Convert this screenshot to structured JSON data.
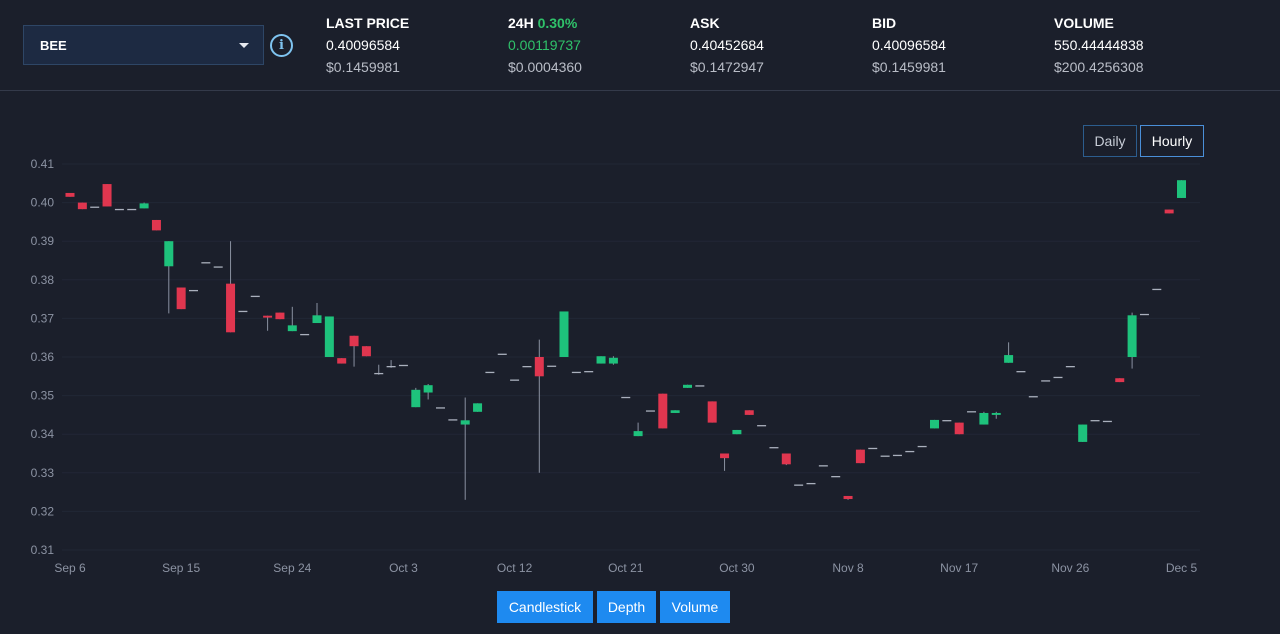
{
  "market": {
    "symbol": "BEE"
  },
  "stats": {
    "last_price": {
      "label": "LAST PRICE",
      "value": "0.40096584",
      "usd": "$0.1459981"
    },
    "change24h": {
      "label": "24H",
      "percent": "0.30%",
      "value": "0.00119737",
      "usd": "$0.0004360"
    },
    "ask": {
      "label": "ASK",
      "value": "0.40452684",
      "usd": "$0.1472947"
    },
    "bid": {
      "label": "BID",
      "value": "0.40096584",
      "usd": "$0.1459981"
    },
    "volume": {
      "label": "VOLUME",
      "value": "550.44444838",
      "usd": "$200.4256308"
    }
  },
  "interval_toggle": {
    "daily": "Daily",
    "hourly": "Hourly",
    "selected": "Hourly"
  },
  "tabs": {
    "candlestick": "Candlestick",
    "depth": "Depth",
    "volume": "Volume"
  },
  "colors": {
    "up": "#1ec27c",
    "down": "#e0364f",
    "accent": "#1e8af0",
    "background": "#1b1f2b"
  },
  "chart_data": {
    "type": "candlestick",
    "ylim": [
      0.31,
      0.41
    ],
    "yticks": [
      "0.31",
      "0.32",
      "0.33",
      "0.34",
      "0.35",
      "0.36",
      "0.37",
      "0.38",
      "0.39",
      "0.40",
      "0.41"
    ],
    "xticks": [
      "Sep 6",
      "Sep 15",
      "Sep 24",
      "Oct 3",
      "Oct 12",
      "Oct 21",
      "Oct 30",
      "Nov 8",
      "Nov 17",
      "Nov 26",
      "Dec 5"
    ],
    "x_start": "Sep 6",
    "candles": [
      {
        "date": "Sep 6",
        "o": 0.4025,
        "h": 0.4025,
        "l": 0.4015,
        "c": 0.4015
      },
      {
        "date": "Sep 7",
        "o": 0.4,
        "h": 0.4,
        "l": 0.3983,
        "c": 0.3983
      },
      {
        "date": "Sep 8",
        "o": 0.3988,
        "h": 0.3988,
        "l": 0.3985,
        "c": 0.3985
      },
      {
        "date": "Sep 9",
        "o": 0.4048,
        "h": 0.4048,
        "l": 0.399,
        "c": 0.399
      },
      {
        "date": "Sep 10",
        "o": 0.3982,
        "h": 0.3982,
        "l": 0.3979,
        "c": 0.3979
      },
      {
        "date": "Sep 11",
        "o": 0.3982,
        "h": 0.3982,
        "l": 0.3979,
        "c": 0.3979
      },
      {
        "date": "Sep 12",
        "o": 0.3985,
        "h": 0.4,
        "l": 0.3985,
        "c": 0.3998
      },
      {
        "date": "Sep 13",
        "o": 0.3955,
        "h": 0.3955,
        "l": 0.3928,
        "c": 0.3928
      },
      {
        "date": "Sep 14",
        "o": 0.3835,
        "h": 0.39,
        "l": 0.3713,
        "c": 0.39
      },
      {
        "date": "Sep 15",
        "o": 0.378,
        "h": 0.378,
        "l": 0.3724,
        "c": 0.3724
      },
      {
        "date": "Sep 16",
        "o": 0.3772,
        "h": 0.3772,
        "l": 0.3769,
        "c": 0.3769
      },
      {
        "date": "Sep 17",
        "o": 0.3844,
        "h": 0.3844,
        "l": 0.3841,
        "c": 0.3841
      },
      {
        "date": "Sep 18",
        "o": 0.3833,
        "h": 0.3833,
        "l": 0.383,
        "c": 0.383
      },
      {
        "date": "Sep 19",
        "o": 0.379,
        "h": 0.39,
        "l": 0.3664,
        "c": 0.3664
      },
      {
        "date": "Sep 20",
        "o": 0.3718,
        "h": 0.3718,
        "l": 0.3715,
        "c": 0.3715
      },
      {
        "date": "Sep 21",
        "o": 0.3757,
        "h": 0.3757,
        "l": 0.3754,
        "c": 0.3754
      },
      {
        "date": "Sep 22",
        "o": 0.3707,
        "h": 0.3707,
        "l": 0.3668,
        "c": 0.3702
      },
      {
        "date": "Sep 23",
        "o": 0.3715,
        "h": 0.3715,
        "l": 0.3698,
        "c": 0.3698
      },
      {
        "date": "Sep 24",
        "o": 0.3667,
        "h": 0.373,
        "l": 0.3667,
        "c": 0.3682
      },
      {
        "date": "Sep 25",
        "o": 0.3658,
        "h": 0.3658,
        "l": 0.3655,
        "c": 0.3655
      },
      {
        "date": "Sep 26",
        "o": 0.3688,
        "h": 0.374,
        "l": 0.3688,
        "c": 0.3708
      },
      {
        "date": "Sep 27",
        "o": 0.36,
        "h": 0.3705,
        "l": 0.36,
        "c": 0.3705
      },
      {
        "date": "Sep 28",
        "o": 0.3597,
        "h": 0.3597,
        "l": 0.3583,
        "c": 0.3583
      },
      {
        "date": "Sep 29",
        "o": 0.3655,
        "h": 0.3655,
        "l": 0.3575,
        "c": 0.3628
      },
      {
        "date": "Sep 30",
        "o": 0.3628,
        "h": 0.3628,
        "l": 0.3602,
        "c": 0.3602
      },
      {
        "date": "Oct 1",
        "o": 0.3557,
        "h": 0.358,
        "l": 0.3554,
        "c": 0.3554
      },
      {
        "date": "Oct 2",
        "o": 0.3575,
        "h": 0.3592,
        "l": 0.3572,
        "c": 0.3572
      },
      {
        "date": "Oct 3",
        "o": 0.3578,
        "h": 0.3578,
        "l": 0.3575,
        "c": 0.3575
      },
      {
        "date": "Oct 4",
        "o": 0.347,
        "h": 0.352,
        "l": 0.347,
        "c": 0.3515
      },
      {
        "date": "Oct 5",
        "o": 0.3508,
        "h": 0.353,
        "l": 0.349,
        "c": 0.3527
      },
      {
        "date": "Oct 6",
        "o": 0.3468,
        "h": 0.3468,
        "l": 0.3465,
        "c": 0.3465
      },
      {
        "date": "Oct 7",
        "o": 0.3437,
        "h": 0.3437,
        "l": 0.3434,
        "c": 0.3434
      },
      {
        "date": "Oct 8",
        "o": 0.3425,
        "h": 0.3495,
        "l": 0.323,
        "c": 0.3436
      },
      {
        "date": "Oct 9",
        "o": 0.3458,
        "h": 0.348,
        "l": 0.3458,
        "c": 0.348
      },
      {
        "date": "Oct 10",
        "o": 0.356,
        "h": 0.356,
        "l": 0.3557,
        "c": 0.3557
      },
      {
        "date": "Oct 11",
        "o": 0.3607,
        "h": 0.3607,
        "l": 0.3604,
        "c": 0.3604
      },
      {
        "date": "Oct 12",
        "o": 0.354,
        "h": 0.354,
        "l": 0.3537,
        "c": 0.3537
      },
      {
        "date": "Oct 13",
        "o": 0.3575,
        "h": 0.3575,
        "l": 0.3572,
        "c": 0.3572
      },
      {
        "date": "Oct 14",
        "o": 0.36,
        "h": 0.3645,
        "l": 0.33,
        "c": 0.355
      },
      {
        "date": "Oct 15",
        "o": 0.3576,
        "h": 0.3576,
        "l": 0.3573,
        "c": 0.3573
      },
      {
        "date": "Oct 16",
        "o": 0.36,
        "h": 0.3718,
        "l": 0.36,
        "c": 0.3718
      },
      {
        "date": "Oct 17",
        "o": 0.356,
        "h": 0.356,
        "l": 0.3557,
        "c": 0.3557
      },
      {
        "date": "Oct 18",
        "o": 0.3562,
        "h": 0.3562,
        "l": 0.3559,
        "c": 0.3559
      },
      {
        "date": "Oct 19",
        "o": 0.3583,
        "h": 0.3602,
        "l": 0.3583,
        "c": 0.3602
      },
      {
        "date": "Oct 20",
        "o": 0.3583,
        "h": 0.3602,
        "l": 0.358,
        "c": 0.3598
      },
      {
        "date": "Oct 21",
        "o": 0.3495,
        "h": 0.3495,
        "l": 0.3492,
        "c": 0.3492
      },
      {
        "date": "Oct 22",
        "o": 0.3395,
        "h": 0.343,
        "l": 0.3395,
        "c": 0.3408
      },
      {
        "date": "Oct 23",
        "o": 0.346,
        "h": 0.346,
        "l": 0.3457,
        "c": 0.3457
      },
      {
        "date": "Oct 24",
        "o": 0.3505,
        "h": 0.3505,
        "l": 0.3415,
        "c": 0.3415
      },
      {
        "date": "Oct 25",
        "o": 0.3455,
        "h": 0.3462,
        "l": 0.3455,
        "c": 0.3462
      },
      {
        "date": "Oct 26",
        "o": 0.352,
        "h": 0.3528,
        "l": 0.352,
        "c": 0.3528
      },
      {
        "date": "Oct 27",
        "o": 0.3525,
        "h": 0.3525,
        "l": 0.3522,
        "c": 0.3522
      },
      {
        "date": "Oct 28",
        "o": 0.3485,
        "h": 0.3485,
        "l": 0.343,
        "c": 0.343
      },
      {
        "date": "Oct 29",
        "o": 0.335,
        "h": 0.335,
        "l": 0.3305,
        "c": 0.3338
      },
      {
        "date": "Oct 30",
        "o": 0.34,
        "h": 0.3411,
        "l": 0.34,
        "c": 0.3411
      },
      {
        "date": "Oct 31",
        "o": 0.3462,
        "h": 0.3462,
        "l": 0.345,
        "c": 0.345
      },
      {
        "date": "Nov 1",
        "o": 0.3422,
        "h": 0.3422,
        "l": 0.3419,
        "c": 0.3419
      },
      {
        "date": "Nov 2",
        "o": 0.3365,
        "h": 0.3365,
        "l": 0.3362,
        "c": 0.3362
      },
      {
        "date": "Nov 3",
        "o": 0.335,
        "h": 0.335,
        "l": 0.332,
        "c": 0.3322
      },
      {
        "date": "Nov 4",
        "o": 0.3268,
        "h": 0.3268,
        "l": 0.3265,
        "c": 0.3265
      },
      {
        "date": "Nov 5",
        "o": 0.3272,
        "h": 0.3272,
        "l": 0.3269,
        "c": 0.3269
      },
      {
        "date": "Nov 6",
        "o": 0.3318,
        "h": 0.3318,
        "l": 0.3315,
        "c": 0.3315
      },
      {
        "date": "Nov 7",
        "o": 0.329,
        "h": 0.329,
        "l": 0.3287,
        "c": 0.3287
      },
      {
        "date": "Nov 8",
        "o": 0.324,
        "h": 0.324,
        "l": 0.323,
        "c": 0.3232
      },
      {
        "date": "Nov 9",
        "o": 0.336,
        "h": 0.336,
        "l": 0.3325,
        "c": 0.3325
      },
      {
        "date": "Nov 10",
        "o": 0.3363,
        "h": 0.3363,
        "l": 0.336,
        "c": 0.336
      },
      {
        "date": "Nov 11",
        "o": 0.3343,
        "h": 0.3343,
        "l": 0.334,
        "c": 0.334
      },
      {
        "date": "Nov 12",
        "o": 0.3345,
        "h": 0.3348,
        "l": 0.3342,
        "c": 0.3345
      },
      {
        "date": "Nov 13",
        "o": 0.3355,
        "h": 0.3355,
        "l": 0.3352,
        "c": 0.3352
      },
      {
        "date": "Nov 14",
        "o": 0.3368,
        "h": 0.3368,
        "l": 0.3365,
        "c": 0.3365
      },
      {
        "date": "Nov 15",
        "o": 0.3415,
        "h": 0.3437,
        "l": 0.3415,
        "c": 0.3437
      },
      {
        "date": "Nov 16",
        "o": 0.3435,
        "h": 0.3435,
        "l": 0.3432,
        "c": 0.3432
      },
      {
        "date": "Nov 17",
        "o": 0.343,
        "h": 0.343,
        "l": 0.34,
        "c": 0.34
      },
      {
        "date": "Nov 18",
        "o": 0.3458,
        "h": 0.3458,
        "l": 0.3455,
        "c": 0.3455
      },
      {
        "date": "Nov 19",
        "o": 0.3425,
        "h": 0.3458,
        "l": 0.3425,
        "c": 0.3455
      },
      {
        "date": "Nov 20",
        "o": 0.345,
        "h": 0.3458,
        "l": 0.344,
        "c": 0.3455
      },
      {
        "date": "Nov 21",
        "o": 0.3585,
        "h": 0.3638,
        "l": 0.3585,
        "c": 0.3605
      },
      {
        "date": "Nov 22",
        "o": 0.3562,
        "h": 0.3562,
        "l": 0.3559,
        "c": 0.3559
      },
      {
        "date": "Nov 23",
        "o": 0.3497,
        "h": 0.3497,
        "l": 0.3494,
        "c": 0.3494
      },
      {
        "date": "Nov 24",
        "o": 0.3538,
        "h": 0.3538,
        "l": 0.3535,
        "c": 0.3535
      },
      {
        "date": "Nov 25",
        "o": 0.3547,
        "h": 0.3547,
        "l": 0.3544,
        "c": 0.3544
      },
      {
        "date": "Nov 26",
        "o": 0.3575,
        "h": 0.3575,
        "l": 0.3572,
        "c": 0.3572
      },
      {
        "date": "Nov 27",
        "o": 0.338,
        "h": 0.3425,
        "l": 0.338,
        "c": 0.3425
      },
      {
        "date": "Nov 28",
        "o": 0.3435,
        "h": 0.3435,
        "l": 0.3432,
        "c": 0.3432
      },
      {
        "date": "Nov 29",
        "o": 0.3433,
        "h": 0.3433,
        "l": 0.343,
        "c": 0.343
      },
      {
        "date": "Nov 30",
        "o": 0.3545,
        "h": 0.3545,
        "l": 0.3535,
        "c": 0.3535
      },
      {
        "date": "Dec 1",
        "o": 0.36,
        "h": 0.3715,
        "l": 0.357,
        "c": 0.3708
      },
      {
        "date": "Dec 2",
        "o": 0.371,
        "h": 0.371,
        "l": 0.3707,
        "c": 0.3707
      },
      {
        "date": "Dec 3",
        "o": 0.3775,
        "h": 0.3775,
        "l": 0.3772,
        "c": 0.3772
      },
      {
        "date": "Dec 4",
        "o": 0.3982,
        "h": 0.3982,
        "l": 0.3972,
        "c": 0.3972
      },
      {
        "date": "Dec 5",
        "o": 0.4012,
        "h": 0.4058,
        "l": 0.4012,
        "c": 0.4058
      }
    ]
  }
}
